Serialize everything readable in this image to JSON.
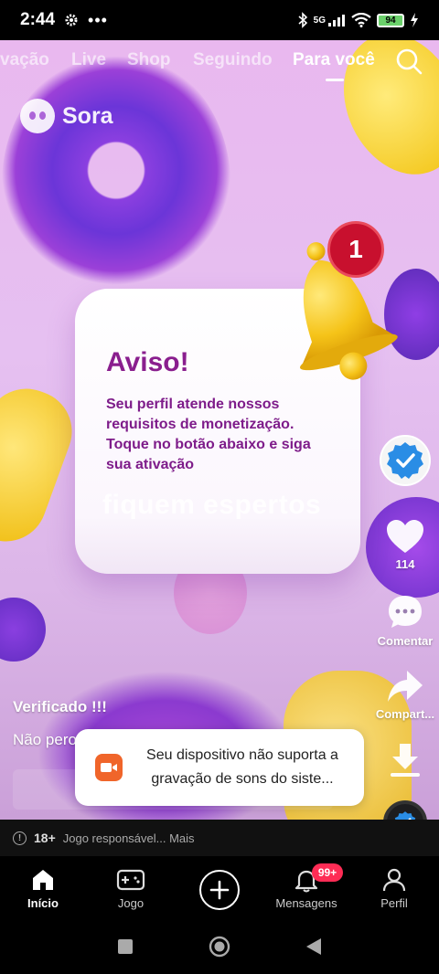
{
  "status_bar": {
    "time": "2:44",
    "dots": "•••",
    "network": "5G",
    "battery": "94"
  },
  "top_nav": {
    "tabs": [
      {
        "label": "vação"
      },
      {
        "label": "Live"
      },
      {
        "label": "Shop"
      },
      {
        "label": "Seguindo"
      },
      {
        "label": "Para você"
      }
    ],
    "active": "Para você"
  },
  "video": {
    "watermark": "Sora",
    "notice_title": "Aviso!",
    "notice_body": "Seu perfil atende nossos requisitos de monetização. Toque no botão abaixo e siga sua ativação",
    "notice_cta": "fiquem espertos",
    "bell_badge": "1"
  },
  "actions": {
    "likes": "114",
    "comment_label": "Comentar",
    "share_label": "Compart..."
  },
  "caption": {
    "username": "Verificado !!!",
    "text": "Não pero"
  },
  "toast": {
    "text": "Seu dispositivo não suporta a gravação de sons do siste..."
  },
  "info_bar": {
    "age": "18+",
    "text": "Jogo responsável... Mais"
  },
  "bottom_nav": {
    "items": [
      {
        "label": "Início"
      },
      {
        "label": "Jogo"
      },
      {
        "label": "Mensagens"
      },
      {
        "label": "Perfil"
      }
    ],
    "messages_badge": "99+"
  },
  "colors": {
    "accent": "#fe2c55",
    "notice_text": "#8a1e8e",
    "toast_icon": "#f0652a"
  }
}
